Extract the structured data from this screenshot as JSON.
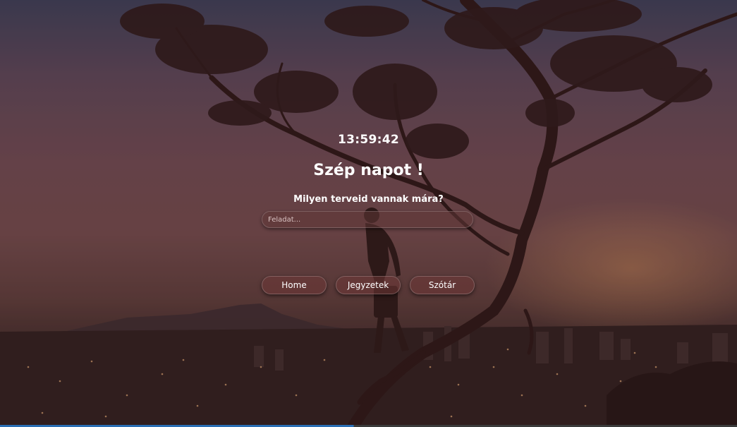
{
  "clock": {
    "time": "13:59:42"
  },
  "greeting": {
    "text": "Szép napot !"
  },
  "plans": {
    "question": "Milyen terveid vannak mára?",
    "input_placeholder": "Feladat...",
    "input_value": ""
  },
  "nav": {
    "items": [
      {
        "label": "Home"
      },
      {
        "label": "Jegyzetek"
      },
      {
        "label": "Szótár"
      }
    ]
  },
  "colors": {
    "text": "#ffffff",
    "button_bg": "#6e3737",
    "sky_top": "#3a3f58",
    "horizon_glow": "#d6945c"
  }
}
